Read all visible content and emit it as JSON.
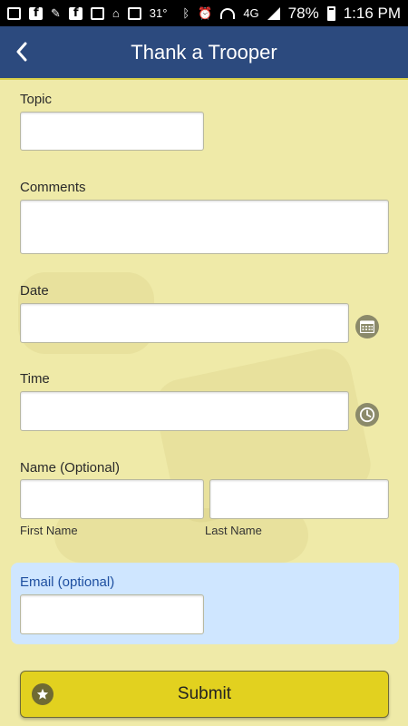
{
  "status_bar": {
    "temperature": "31°",
    "network": "4G",
    "battery_percent": "78%",
    "battery_level": 0.78,
    "time": "1:16 PM"
  },
  "header": {
    "title": "Thank a Trooper",
    "back_icon": "chevron-left-icon"
  },
  "form": {
    "topic_label": "Topic",
    "topic_value": "",
    "comments_label": "Comments",
    "comments_value": "",
    "date_label": "Date",
    "date_value": "",
    "date_icon": "calendar-icon",
    "time_label": "Time",
    "time_value": "",
    "time_icon": "clock-icon",
    "name_label": "Name (Optional)",
    "first_name_value": "",
    "first_name_sublabel": "First Name",
    "last_name_value": "",
    "last_name_sublabel": "Last Name",
    "email_label": "Email (optional)",
    "email_value": ""
  },
  "submit": {
    "label": "Submit",
    "icon": "star-icon"
  },
  "colors": {
    "header_bg": "#2c4a7e",
    "page_bg": "#efeaa8",
    "email_panel_bg": "#cfe6ff",
    "submit_bg": "#e2d11f"
  }
}
